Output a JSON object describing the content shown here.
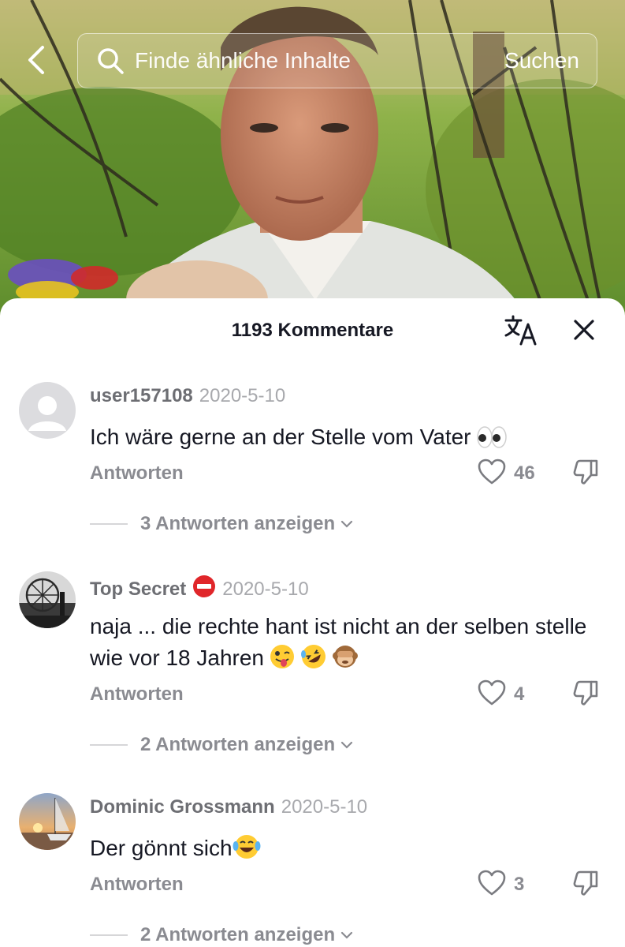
{
  "search": {
    "placeholder": "Finde ähnliche Inhalte",
    "submit_label": "Suchen"
  },
  "icons": {
    "back": "back-arrow-icon",
    "search": "search-icon",
    "translate": "translate-icon",
    "close": "close-icon",
    "like": "heart-outline-icon",
    "dislike": "thumbs-down-icon",
    "chevron": "chevron-down-icon"
  },
  "sheet": {
    "title": "1193 Kommentare"
  },
  "comments": [
    {
      "username": "user157108",
      "date": "2020-5-10",
      "text": "Ich wäre gerne an der Stelle vom Vater",
      "emojis": [
        "eyes"
      ],
      "reply_label": "Antworten",
      "likes": "46",
      "view_replies": "3 Antworten anzeigen",
      "avatar": "default-avatar"
    },
    {
      "username": "Top Secret",
      "badge": "no-entry",
      "date": "2020-5-10",
      "text": "naja ... die rechte hant ist nicht an der selben stelle wie vor 18 Jahren",
      "emojis": [
        "winking-face-with-tongue",
        "rolling-on-the-floor-laughing",
        "see-no-evil-monkey"
      ],
      "reply_label": "Antworten",
      "likes": "4",
      "view_replies": "2 Antworten anzeigen",
      "avatar": "ferris-wheel-photo"
    },
    {
      "username": "Dominic Grossmann",
      "date": "2020-5-10",
      "text": "Der gönnt sich",
      "emojis": [
        "face-with-tears-of-joy"
      ],
      "reply_label": "Antworten",
      "likes": "3",
      "view_replies": "2 Antworten anzeigen",
      "avatar": "sailboat-sunset-photo"
    }
  ],
  "colors": {
    "primary_text": "#161823",
    "secondary_text": "#8a8b91",
    "username": "#6d6e73",
    "date": "#a8a9ad"
  }
}
